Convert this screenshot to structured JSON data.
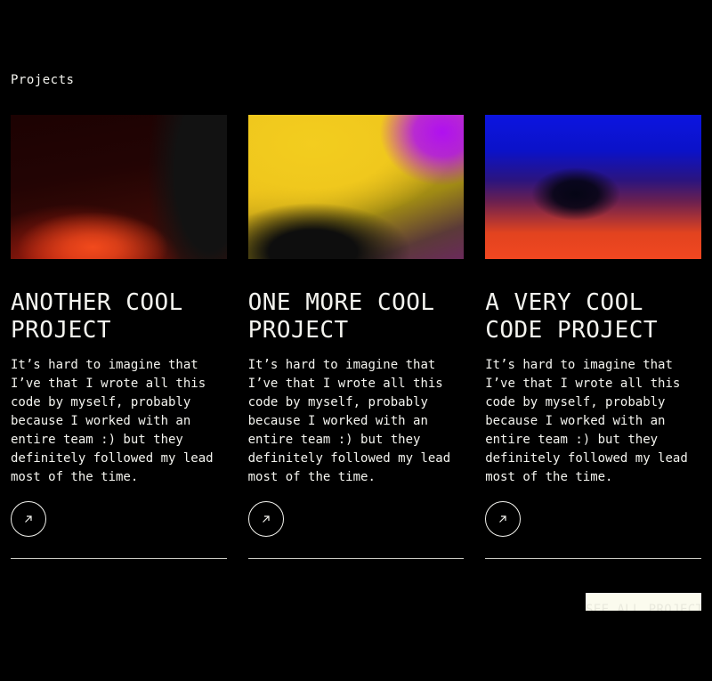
{
  "section": {
    "label": "Projects"
  },
  "projects": [
    {
      "title": "ANOTHER COOL\nPROJECT",
      "description": "It’s hard to imagine that I’ve that I wrote all this code by myself, probably because I worked with an entire team :) but they definitely followed my lead most of the time.",
      "link_icon": "arrow-up-right-icon"
    },
    {
      "title": "ONE MORE COOL\nPROJECT",
      "description": "It’s hard to imagine that I’ve that I wrote all this code by myself, probably because I worked with an entire team :) but they definitely followed my lead most of the time.",
      "link_icon": "arrow-up-right-icon"
    },
    {
      "title": "A VERY COOL\nCODE PROJECT",
      "description": "It’s hard to imagine that I’ve that I wrote all this code by myself, probably because I worked with an entire team :) but they definitely followed my lead most of the time.",
      "link_icon": "arrow-up-right-icon"
    }
  ],
  "footer": {
    "see_all_label": "SEE ALL PROJECTS"
  },
  "colors": {
    "background": "#000000",
    "text": "#f4f4ef",
    "button_bg": "#fbfbee"
  }
}
